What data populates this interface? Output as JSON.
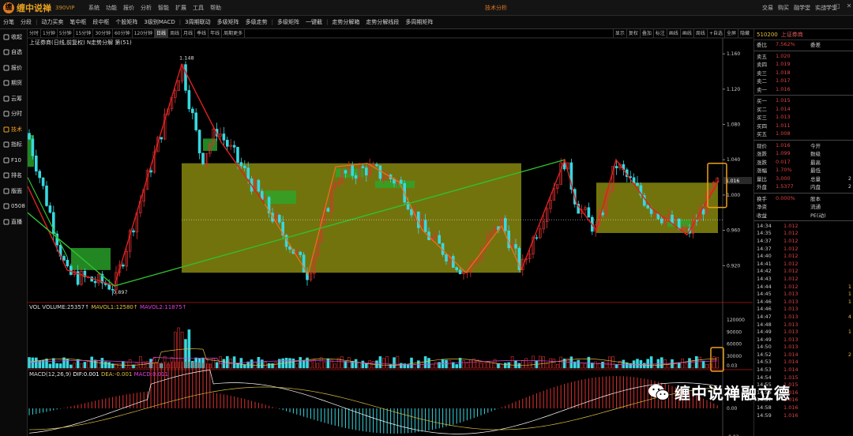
{
  "app": {
    "name": "缠中说禅",
    "version": "390VIP",
    "window_title": "技术分析"
  },
  "top_menu": [
    "系统",
    "功能",
    "报价",
    "分析",
    "智能",
    "扩展",
    "工具",
    "帮助"
  ],
  "right_menu": [
    "交易",
    "购买",
    "融学堂",
    "实战学堂"
  ],
  "toolbar": [
    "分笔",
    "分段",
    "动力买卖",
    "笔中枢",
    "段中枢",
    "个股矩阵",
    "3级别MACD",
    "3周期联动",
    "多级矩阵",
    "多级走势",
    "多级矩阵",
    "一键截",
    "走势分解箱",
    "走势分解线段",
    "多周期矩阵"
  ],
  "sidebar": [
    {
      "label": "收起",
      "icon": "collapse-icon"
    },
    {
      "label": "自选",
      "icon": "star-icon"
    },
    {
      "label": "报价",
      "icon": "quote-icon"
    },
    {
      "label": "期货",
      "icon": "futures-icon"
    },
    {
      "label": "云筹",
      "icon": "cloud-icon"
    },
    {
      "label": "分时",
      "icon": "clock-icon"
    },
    {
      "label": "技术",
      "icon": "candle-icon",
      "active": true
    },
    {
      "label": "指标",
      "icon": "indicator-icon"
    },
    {
      "label": "F10",
      "icon": "f10-icon"
    },
    {
      "label": "排名",
      "icon": "rank-icon"
    },
    {
      "label": "版面",
      "icon": "layout-icon"
    },
    {
      "label": "0508",
      "icon": "chart-icon"
    },
    {
      "label": "直播",
      "icon": "live-icon"
    }
  ],
  "periods": [
    "分时",
    "1分钟",
    "5分钟",
    "15分钟",
    "30分钟",
    "60分钟",
    "120分钟",
    "日线",
    "周线",
    "月线",
    "季线",
    "年线",
    "周期更多"
  ],
  "selected_period": "日线",
  "chart_tools": [
    "显示",
    "复权",
    "叠加",
    "标注",
    "画线",
    "画线",
    "周线",
    "+自选",
    "全屏",
    "隐藏"
  ],
  "chart_title": "上证券商(日线,前复权) N走势分解 第(51)",
  "price_axis": [
    "1.160",
    "1.120",
    "1.080",
    "1.040",
    "1.000",
    "0.960",
    "0.920"
  ],
  "price_tag": "1.016",
  "annotations": {
    "high": "1.148",
    "low": "0.897"
  },
  "volume": {
    "label_vol": "VOL VOLUME:25357↑",
    "label_ma1": "MAVOL1:12580↑",
    "label_ma2": "MAVOL2:11875↑",
    "axis": [
      "120000",
      "90000",
      "60000",
      "30000"
    ]
  },
  "macd": {
    "label_macd": "MACD(12,26,9)",
    "label_dif": "DIF:0.001",
    "label_dea": "DEA:-0.001",
    "label_m": "MACD:0.011",
    "axis": [
      "0.03",
      "0.00",
      "-0.02"
    ]
  },
  "quote": {
    "code": "510200",
    "name": "上证券商",
    "committee": {
      "k": "委比",
      "v": "7.562%",
      "k2": "委差",
      "v2": ""
    },
    "asks": [
      {
        "k": "卖五",
        "v": "1.020",
        "vol": ""
      },
      {
        "k": "卖四",
        "v": "1.019",
        "vol": ""
      },
      {
        "k": "卖三",
        "v": "1.018",
        "vol": ""
      },
      {
        "k": "卖二",
        "v": "1.017",
        "vol": ""
      },
      {
        "k": "卖一",
        "v": "1.016",
        "vol": ""
      }
    ],
    "bids": [
      {
        "k": "买一",
        "v": "1.015",
        "vol": ""
      },
      {
        "k": "买二",
        "v": "1.014",
        "vol": ""
      },
      {
        "k": "买三",
        "v": "1.013",
        "vol": ""
      },
      {
        "k": "买四",
        "v": "1.011",
        "vol": ""
      },
      {
        "k": "买五",
        "v": "1.008",
        "vol": ""
      }
    ],
    "stats": [
      {
        "k": "现价",
        "v": "1.016",
        "k2": "今开",
        "v2": ""
      },
      {
        "k": "涨跌",
        "v": "1.099",
        "k2": "数级",
        "v2": ""
      },
      {
        "k": "涨跌",
        "v": "0.017",
        "k2": "最高",
        "v2": ""
      },
      {
        "k": "涨幅",
        "v": "1.70%",
        "k2": "最低",
        "v2": ""
      },
      {
        "k": "量比",
        "v": "3,000",
        "k2": "总量",
        "v2": "2"
      },
      {
        "k": "外盘",
        "v": "1.5377",
        "k2": "内盘",
        "v2": "2"
      }
    ],
    "extra": [
      {
        "k": "换手",
        "v": "0.000%",
        "k2": "股本"
      },
      {
        "k": "净资",
        "v": "",
        "k2": "流通"
      },
      {
        "k": "收益",
        "v": "",
        "k2": "PE(动)"
      }
    ],
    "ticks": [
      {
        "t": "14:34",
        "p": "1.012",
        "n": ""
      },
      {
        "t": "14:35",
        "p": "1.012",
        "n": ""
      },
      {
        "t": "14:37",
        "p": "1.012",
        "n": ""
      },
      {
        "t": "14:37",
        "p": "1.012",
        "n": ""
      },
      {
        "t": "14:40",
        "p": "1.012",
        "n": ""
      },
      {
        "t": "14:41",
        "p": "1.012",
        "n": ""
      },
      {
        "t": "14:42",
        "p": "1.012",
        "n": ""
      },
      {
        "t": "14:43",
        "p": "1.012",
        "n": ""
      },
      {
        "t": "14:44",
        "p": "1.012",
        "n": "1"
      },
      {
        "t": "14:45",
        "p": "1.013",
        "n": "1"
      },
      {
        "t": "14:46",
        "p": "1.013",
        "n": "1"
      },
      {
        "t": "14:46",
        "p": "1.013",
        "n": ""
      },
      {
        "t": "14:47",
        "p": "1.013",
        "n": "4"
      },
      {
        "t": "14:48",
        "p": "1.013",
        "n": ""
      },
      {
        "t": "14:49",
        "p": "1.013",
        "n": "1"
      },
      {
        "t": "14:49",
        "p": "1.013",
        "n": ""
      },
      {
        "t": "14:50",
        "p": "1.013",
        "n": ""
      },
      {
        "t": "14:52",
        "p": "1.014",
        "n": "2"
      },
      {
        "t": "14:53",
        "p": "1.014",
        "n": ""
      },
      {
        "t": "14:53",
        "p": "1.014",
        "n": ""
      },
      {
        "t": "14:54",
        "p": "1.015",
        "n": ""
      },
      {
        "t": "14:55",
        "p": "1.015",
        "n": ""
      },
      {
        "t": "14:56",
        "p": "1.016",
        "n": ""
      },
      {
        "t": "14:57",
        "p": "1.016",
        "n": ""
      },
      {
        "t": "14:58",
        "p": "1.016",
        "n": ""
      },
      {
        "t": "14:59",
        "p": "1.016",
        "n": ""
      }
    ]
  },
  "watermark": "缠中说禅融立德",
  "colors": {
    "up": "#e03030",
    "down": "#38d8e0",
    "box": "#9a9a12",
    "pivot": "#2aa82a",
    "ma1": "#e0c040",
    "ma2": "#e040e0",
    "accent": "#f0a020"
  }
}
